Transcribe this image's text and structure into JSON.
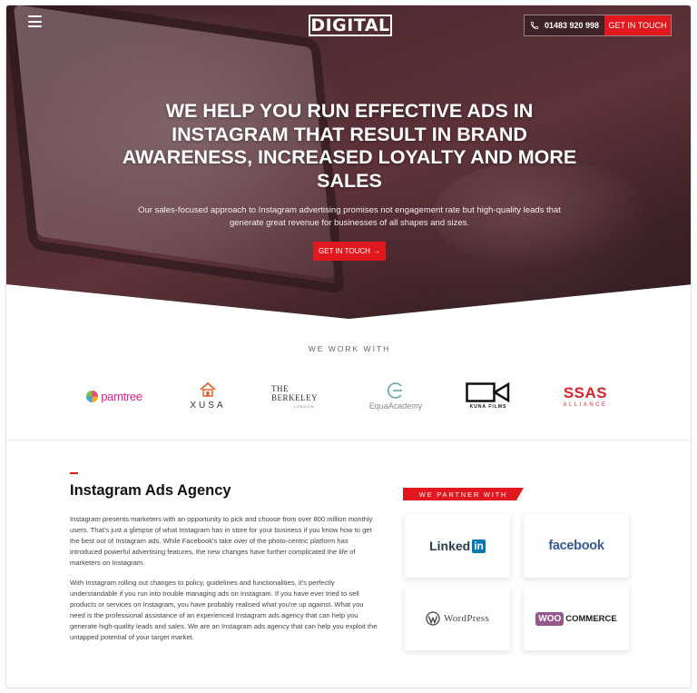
{
  "header": {
    "logo_text": "DIGITAL",
    "phone": "01483 920 998",
    "cta_label": "GET IN TOUCH"
  },
  "hero": {
    "title": "WE HELP YOU RUN EFFECTIVE ADS IN INSTAGRAM THAT RESULT IN BRAND AWARENESS, INCREASED LOYALTY AND MORE SALES",
    "subtitle": "Our sales-focused approach to Instagram advertising promises not engagement rate but high-quality leads that generate great revenue for businesses of all shapes and sizes.",
    "cta_label": "GET IN TOUCH",
    "cta_arrow": "→"
  },
  "clients": {
    "title": "WE WORK WITH",
    "logos": [
      {
        "name": "pamtree"
      },
      {
        "name": "XUSA"
      },
      {
        "name": "THE BERKELEY",
        "sub": "LONDON"
      },
      {
        "name": "EquaAcademy"
      },
      {
        "name": "KUNA FILMS"
      },
      {
        "name": "SSAS",
        "sub": "ALLIANCE"
      }
    ]
  },
  "agency": {
    "title": "Instagram Ads Agency",
    "paragraph1": "Instagram presents marketers with an opportunity to pick and choose from over 800 million monthly users. That's just a glimpse of what Instagram has in store for your business if you know how to get the best out of Instagram ads. While Facebook's take over of the photo-centric platform has introduced powerful advertising features, the new changes have further complicated the life of marketers on Instagram.",
    "paragraph2": "With Instagram rolling out changes to policy, guidelines and functionalities, it's perfectly understandable if you run into trouble managing ads on Instagram. If you have ever tried to sell products or services on Instagram, you have probably realised what you're up against. What you need is the professional assistance of an experienced Instagram ads agency that can help you generate high-quality leads and sales. We are an Instagram ads agency that can help you exploit the untapped potential of your target market."
  },
  "partners": {
    "label": "WE PARTNER WITH",
    "linkedin": {
      "word": "Linked",
      "box": "in"
    },
    "facebook": "facebook",
    "wordpress": "WordPress",
    "woo": {
      "badge": "WOO",
      "word": "COMMERCE"
    }
  },
  "colors": {
    "accent": "#e2181f",
    "hero_dark": "#3b2226"
  }
}
